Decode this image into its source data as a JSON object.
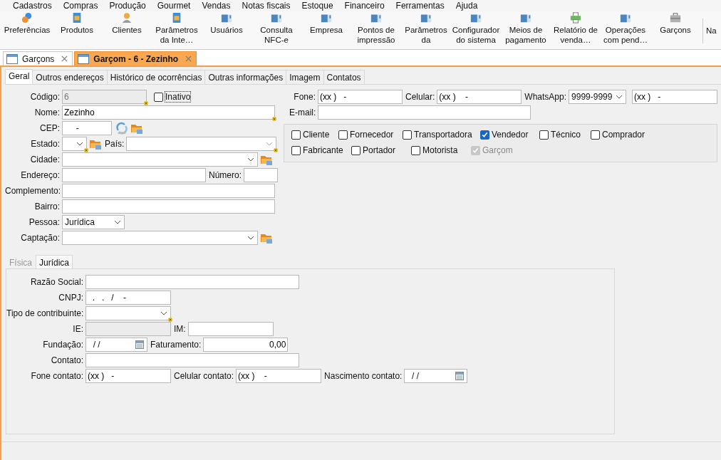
{
  "menu": [
    "Cadastros",
    "Compras",
    "Produção",
    "Gourmet",
    "Vendas",
    "Notas fiscais",
    "Estoque",
    "Financeiro",
    "Ferramentas",
    "Ajuda"
  ],
  "toolbar": [
    {
      "label": "Preferências",
      "kind": "gear"
    },
    {
      "label": "Produtos",
      "kind": "doc"
    },
    {
      "label": "Clientes",
      "kind": "person"
    },
    {
      "label": "Parâmetros da Inte…",
      "kind": "doc"
    },
    {
      "label": "Usuários",
      "kind": "window"
    },
    {
      "label": "Consulta NFC-e",
      "kind": "window"
    },
    {
      "label": "Empresa",
      "kind": "window"
    },
    {
      "label": "Pontos de impressão",
      "kind": "window"
    },
    {
      "label": "Parâmetros da",
      "kind": "window"
    },
    {
      "label": "Configurador do sistema",
      "kind": "window"
    },
    {
      "label": "Meios de pagamento",
      "kind": "window"
    },
    {
      "label": "Relatório de venda…",
      "kind": "printer"
    },
    {
      "label": "Operações com pend…",
      "kind": "window"
    },
    {
      "label": "Garçons",
      "kind": "case"
    },
    {
      "label": "Na",
      "kind": "none"
    }
  ],
  "doc_tabs": [
    {
      "label": "Garçons",
      "selected": false
    },
    {
      "label": "Garçom - 6 - Zezinho",
      "selected": true
    }
  ],
  "form_tabs": [
    {
      "label": "Geral",
      "selected": true
    },
    {
      "label": "Outros endereços",
      "selected": false
    },
    {
      "label": "Histórico de ocorrências",
      "selected": false
    },
    {
      "label": "Outras informações",
      "selected": false
    },
    {
      "label": "Imagem",
      "selected": false
    },
    {
      "label": "Contatos",
      "selected": false
    }
  ],
  "codigo": {
    "label": "Código:",
    "value": "6",
    "disabled": true,
    "required": true
  },
  "inativo": {
    "label": "Inativo",
    "checked": false
  },
  "nome": {
    "label": "Nome:",
    "value": "Zezinho",
    "required": true
  },
  "cep": {
    "label": "CEP:",
    "value": "     -"
  },
  "estado": {
    "label": "Estado:",
    "required": true
  },
  "pais": {
    "label": "País:",
    "required": true
  },
  "cidade": {
    "label": "Cidade:"
  },
  "endereco": {
    "label": "Endereço:"
  },
  "numero": {
    "label": "Número:"
  },
  "complemento": {
    "label": "Complemento:"
  },
  "bairro": {
    "label": "Bairro:"
  },
  "pessoa": {
    "label": "Pessoa:",
    "value": "Jurídica"
  },
  "captacao": {
    "label": "Captação:"
  },
  "fone": {
    "label": "Fone:",
    "value": "(xx )   -"
  },
  "celular": {
    "label": "Celular:",
    "value": "(xx )    -"
  },
  "whatsapp": {
    "label": "WhatsApp:",
    "format": "9999-9999",
    "value": "(xx )   -"
  },
  "email": {
    "label": "E-mail:"
  },
  "roles": [
    {
      "label": "Cliente",
      "checked": false,
      "disabled": false
    },
    {
      "label": "Fornecedor",
      "checked": false,
      "disabled": false
    },
    {
      "label": "Transportadora",
      "checked": false,
      "disabled": false
    },
    {
      "label": "Vendedor",
      "checked": true,
      "disabled": false
    },
    {
      "label": "Técnico",
      "checked": false,
      "disabled": false
    },
    {
      "label": "Comprador",
      "checked": false,
      "disabled": false
    },
    {
      "label": "Fabricante",
      "checked": false,
      "disabled": false
    },
    {
      "label": "Portador",
      "checked": false,
      "disabled": false
    },
    {
      "label": "Motorista",
      "checked": false,
      "disabled": false
    },
    {
      "label": "Garçom",
      "checked": true,
      "disabled": true
    }
  ],
  "person_tabs": [
    {
      "label": "Física",
      "selected": false
    },
    {
      "label": "Jurídica",
      "selected": true
    }
  ],
  "razao_social": {
    "label": "Razão Social:"
  },
  "cnpj": {
    "label": "CNPJ:",
    "value": "  .   .   /    -"
  },
  "tipo_contribuinte": {
    "label": "Tipo de contribuinte:",
    "required": true
  },
  "ie": {
    "label": "IE:",
    "disabled": true
  },
  "im": {
    "label": "IM:"
  },
  "fundacao": {
    "label": "Fundação:",
    "value": "  / /"
  },
  "faturamento": {
    "label": "Faturamento:",
    "value": "0,00"
  },
  "contato": {
    "label": "Contato:"
  },
  "fone_contato": {
    "label": "Fone contato:",
    "value": "(xx )   -"
  },
  "celular_contato": {
    "label": "Celular contato:",
    "value": "(xx )    -"
  },
  "nascimento_contato": {
    "label": "Nascimento contato:",
    "value": "  / /"
  }
}
